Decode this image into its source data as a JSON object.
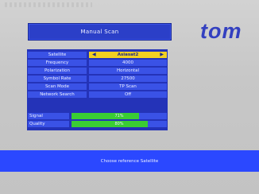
{
  "title": "Manual Scan",
  "brand": "tom",
  "settings": [
    {
      "label": "Satellite",
      "value": "Asiasat2",
      "selected": true
    },
    {
      "label": "Frequency",
      "value": "4000"
    },
    {
      "label": "Polarization",
      "value": "Horizontal"
    },
    {
      "label": "Symbol Rate",
      "value": "27500"
    },
    {
      "label": "Scan Mode",
      "value": "TP Scan"
    },
    {
      "label": "Network Search",
      "value": "Off"
    }
  ],
  "meters": [
    {
      "label": "Signal",
      "level": 0.71,
      "text": "71%"
    },
    {
      "label": "Quality",
      "level": 0.8,
      "text": "80%"
    }
  ],
  "help": "Choose reference Satellite",
  "colors": {
    "background": "#c9c9c9",
    "panel": "#2433b8",
    "cell": "#3a52e6",
    "selected": "#f2d022",
    "meter_fill": "#3acd34",
    "help_bar": "#2b48ff",
    "brand": "#3340c0"
  }
}
